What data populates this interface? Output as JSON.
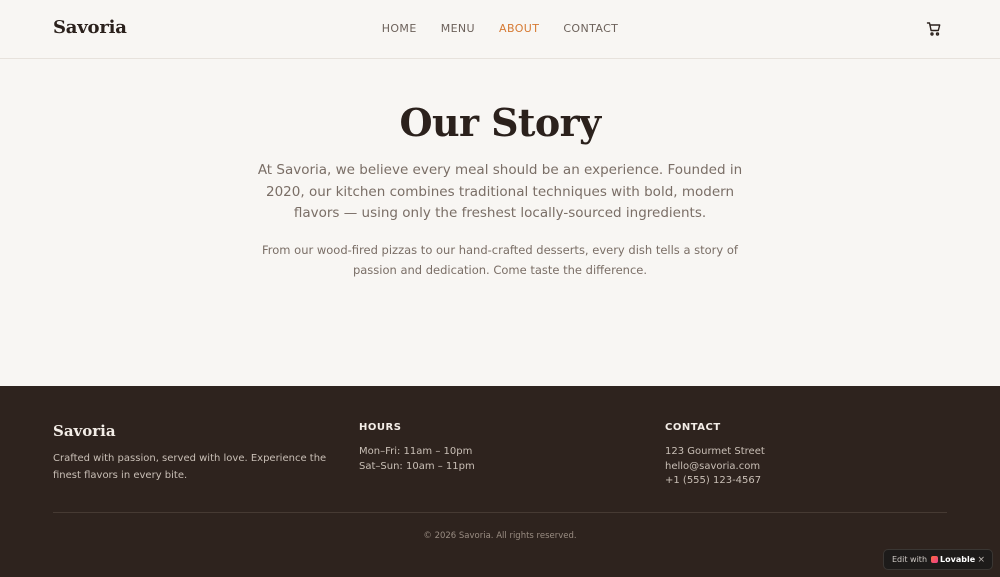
{
  "header": {
    "logo": "Savoria",
    "nav": [
      {
        "label": "HOME",
        "active": false
      },
      {
        "label": "MENU",
        "active": false
      },
      {
        "label": "ABOUT",
        "active": true
      },
      {
        "label": "CONTACT",
        "active": false
      }
    ],
    "cart_icon": "cart-icon"
  },
  "story": {
    "title": "Our Story",
    "lead": "At Savoria, we believe every meal should be an experience. Founded in 2020, our kitchen combines traditional techniques with bold, modern flavors — using only the freshest locally-sourced ingredients.",
    "sub": "From our wood-fired pizzas to our hand-crafted desserts, every dish tells a story of passion and dedication. Come taste the difference."
  },
  "footer": {
    "brand": "Savoria",
    "tagline": "Crafted with passion, served with love. Experience the finest flavors in every bite.",
    "hours": {
      "heading": "HOURS",
      "lines": [
        "Mon–Fri: 11am – 10pm",
        "Sat–Sun: 10am – 11pm"
      ]
    },
    "contact": {
      "heading": "CONTACT",
      "lines": [
        "123 Gourmet Street",
        "hello@savoria.com",
        "+1 (555) 123-4567"
      ]
    },
    "copyright": "© 2026 Savoria. All rights reserved."
  },
  "badge": {
    "prefix": "Edit with",
    "brand": "Lovable",
    "close": "×"
  },
  "colors": {
    "accent": "#d67a33",
    "background": "#f8f6f3",
    "footer_bg": "#2e231e",
    "text_dark": "#2b211c"
  }
}
